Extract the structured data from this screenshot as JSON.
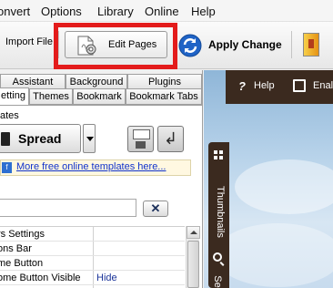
{
  "menu": [
    "onvert",
    "Options",
    "Library",
    "Online",
    "Help"
  ],
  "toolbar": {
    "import_label": "Import File",
    "edit_pages_label": "Edit Pages",
    "apply_change_label": "Apply Change"
  },
  "tabs": {
    "row1": [
      "Assistant",
      "Background",
      "Plugins"
    ],
    "row2": [
      "etting",
      "Themes",
      "Bookmark",
      "Bookmark Tabs"
    ]
  },
  "templates": {
    "label": "ates",
    "spread_label": "Spread",
    "more_link": "More free online templates here..."
  },
  "search": {
    "value": "",
    "clear_label": "✕"
  },
  "properties": [
    {
      "name": "rs Settings",
      "value": ""
    },
    {
      "name": "ons Bar",
      "value": ""
    },
    {
      "name": "me Button",
      "value": ""
    },
    {
      "name": "ome Button Visible",
      "value": "Hide"
    }
  ],
  "preview": {
    "help_label": "Help",
    "fullscreen_label": "Enal",
    "thumbnails_label": "Thumbnails",
    "search_label": "Se"
  },
  "colors": {
    "highlight": "#e31b1b",
    "preview_bar": "#3b2a1f",
    "link": "#1133cc"
  },
  "icons": [
    "edit-pages-icon",
    "apply-change-icon",
    "book-icon",
    "save-icon",
    "import-template-icon",
    "info-icon",
    "help-icon",
    "fullscreen-icon",
    "grid-icon",
    "search-icon"
  ]
}
